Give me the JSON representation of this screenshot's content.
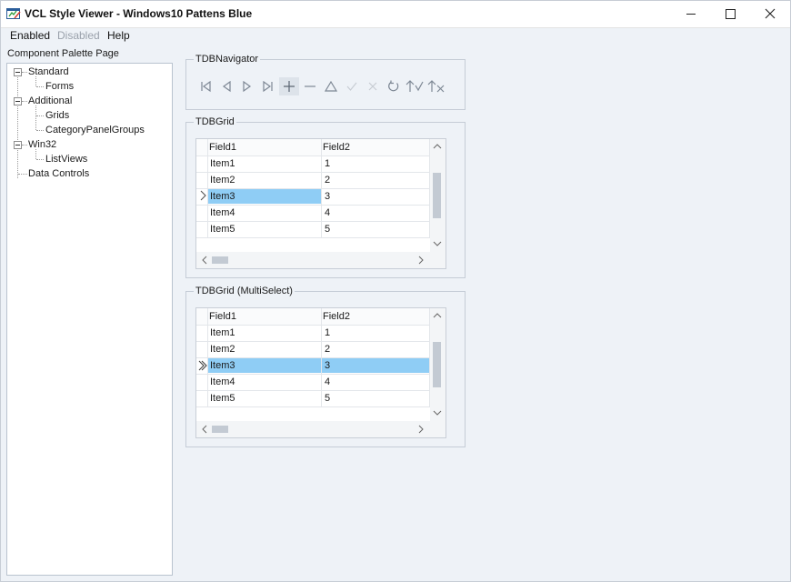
{
  "window": {
    "title": "VCL Style Viewer - Windows10 Pattens Blue",
    "minimize_glyph": "—",
    "maximize_glyph": "☐",
    "close_glyph": "✕"
  },
  "menu": {
    "items": [
      "Enabled",
      "Disabled",
      "Help"
    ]
  },
  "sidebar": {
    "label": "Component Palette Page",
    "tree": [
      {
        "label": "Standard",
        "children": [
          "Forms"
        ]
      },
      {
        "label": "Additional",
        "children": [
          "Grids",
          "CategoryPanelGroups"
        ]
      },
      {
        "label": "Win32",
        "children": [
          "ListViews"
        ]
      },
      {
        "label": "Data Controls",
        "children": []
      }
    ]
  },
  "navigator": {
    "title": "TDBNavigator",
    "buttons": [
      "first-icon",
      "prior-icon",
      "next-icon",
      "last-icon",
      "insert-icon",
      "delete-icon",
      "edit-icon",
      "post-icon",
      "cancel-icon",
      "refresh-icon",
      "apply-updates-icon",
      "cancel-updates-icon"
    ]
  },
  "grid1": {
    "title": "TDBGrid",
    "columns": [
      "Field1",
      "Field2"
    ],
    "rows": [
      [
        "Item1",
        "1"
      ],
      [
        "Item2",
        "2"
      ],
      [
        "Item3",
        "3"
      ],
      [
        "Item4",
        "4"
      ],
      [
        "Item5",
        "5"
      ]
    ],
    "selected_row": 3,
    "indicator": "›"
  },
  "grid2": {
    "title": "TDBGrid (MultiSelect)",
    "columns": [
      "Field1",
      "Field2"
    ],
    "rows": [
      [
        "Item1",
        "1"
      ],
      [
        "Item2",
        "2"
      ],
      [
        "Item3",
        "3"
      ],
      [
        "Item4",
        "4"
      ],
      [
        "Item5",
        "5"
      ]
    ],
    "selected_row": 3,
    "indicator": "»"
  },
  "colors": {
    "selection": "#8fcdf5",
    "background": "#eef2f7",
    "accent": "#3a8fd6"
  }
}
